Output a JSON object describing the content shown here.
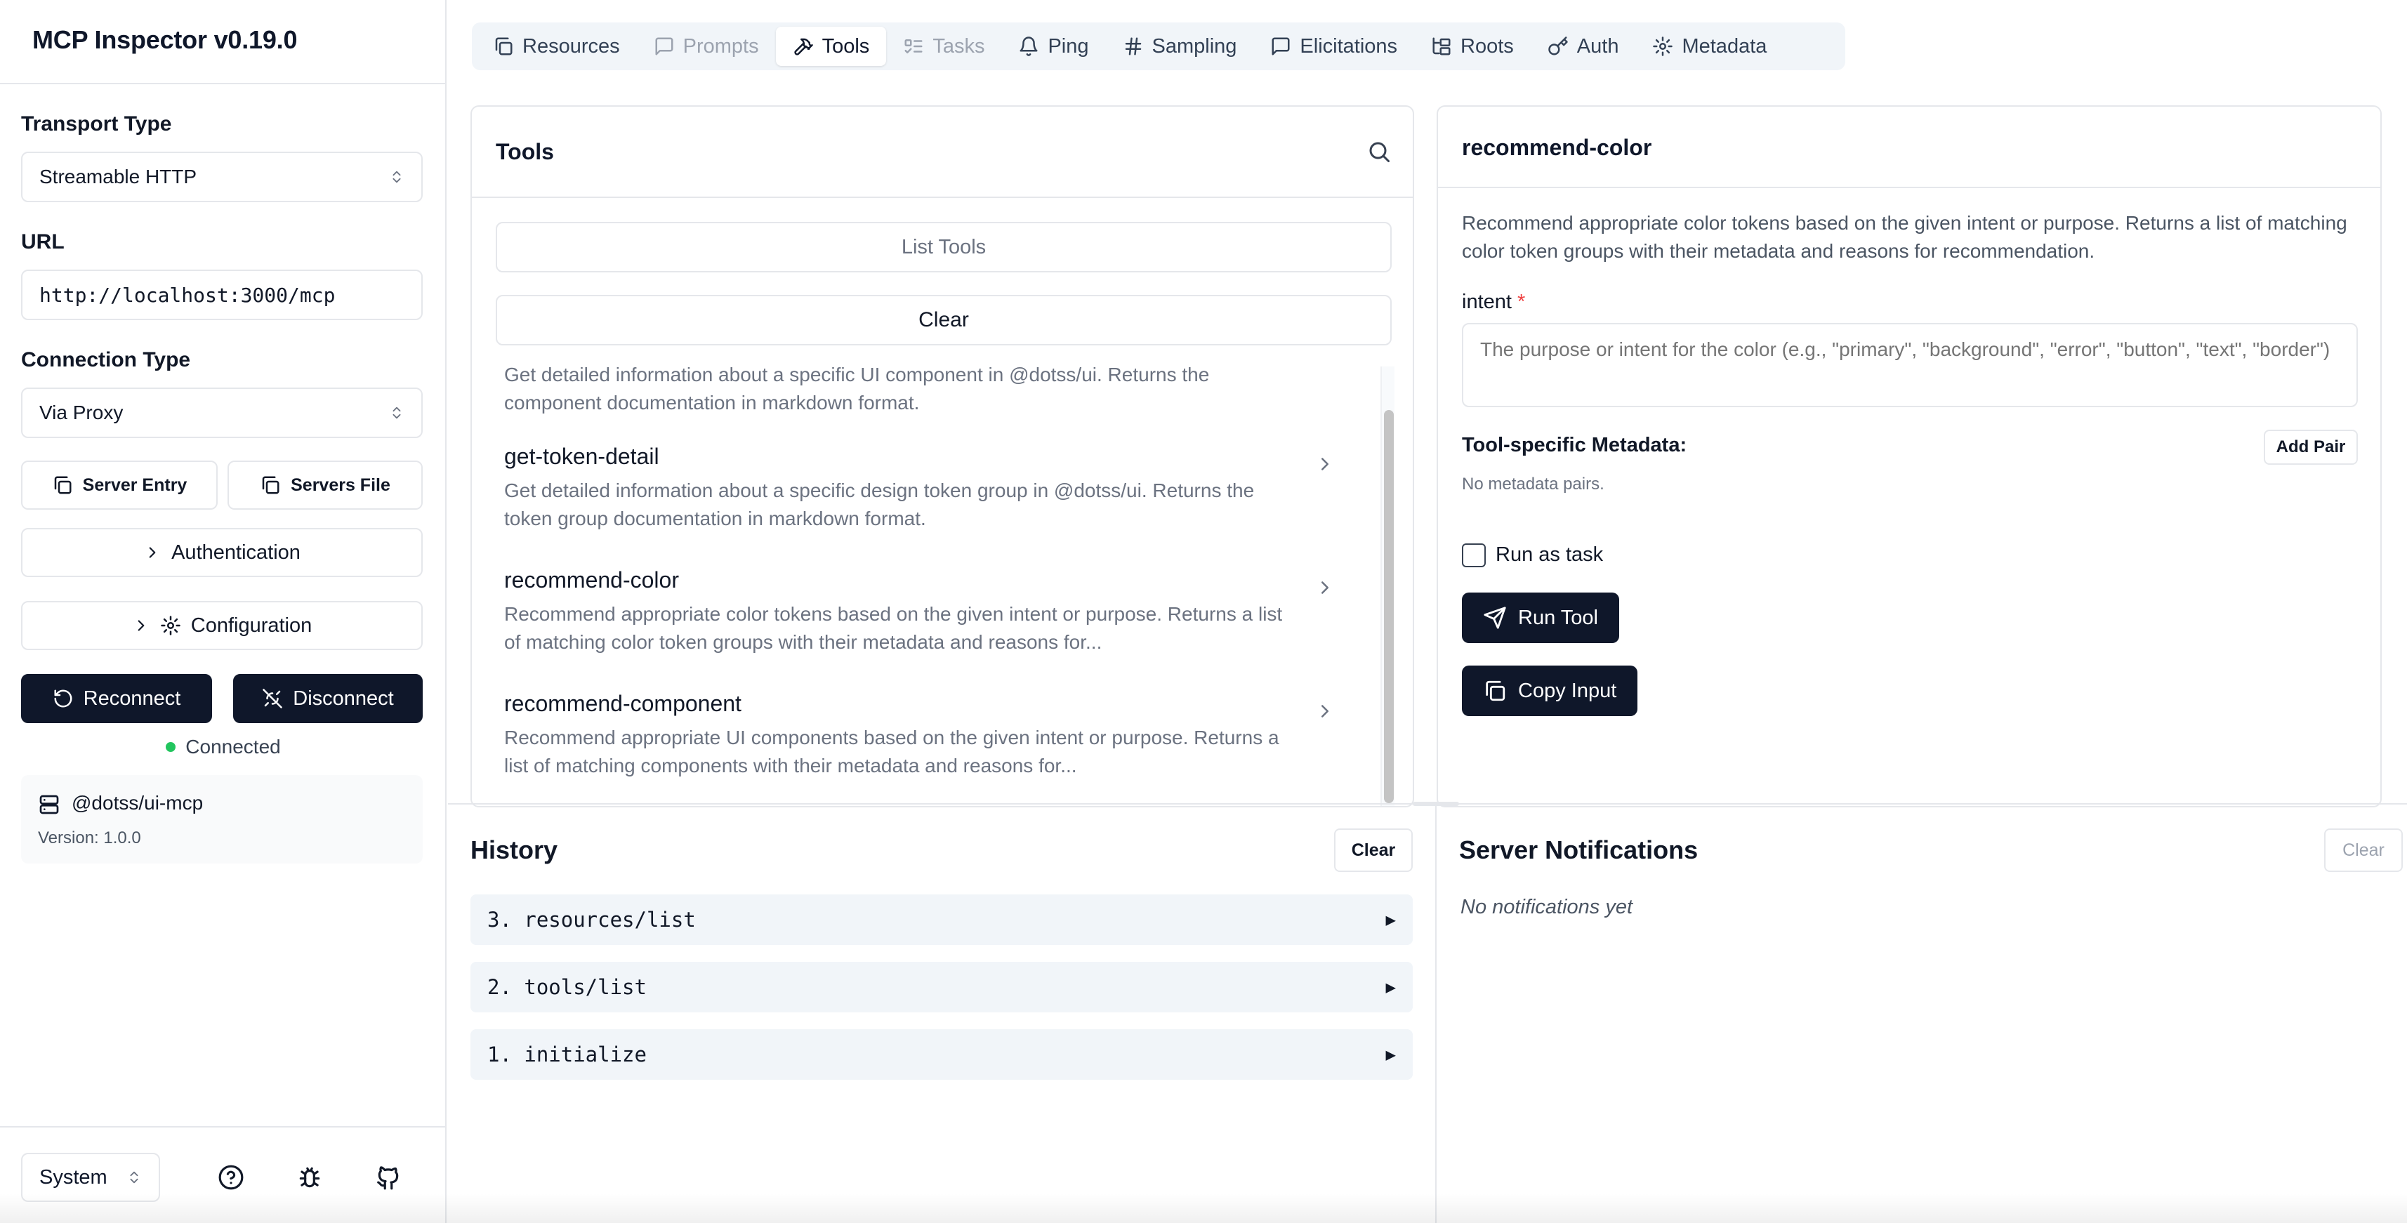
{
  "app": {
    "title": "MCP Inspector v0.19.0"
  },
  "sidebar": {
    "transport_label": "Transport Type",
    "transport_value": "Streamable HTTP",
    "url_label": "URL",
    "url_value": "http://localhost:3000/mcp",
    "connection_label": "Connection Type",
    "connection_value": "Via Proxy",
    "server_entry_label": "Server Entry",
    "servers_file_label": "Servers File",
    "authentication_label": "Authentication",
    "configuration_label": "Configuration",
    "reconnect_label": "Reconnect",
    "disconnect_label": "Disconnect",
    "status_text": "Connected",
    "status_color": "#22c55e",
    "server_name": "@dotss/ui-mcp",
    "server_version": "Version: 1.0.0",
    "theme_value": "System"
  },
  "tabs": [
    {
      "label": "Resources",
      "icon": "files-icon",
      "state": "normal"
    },
    {
      "label": "Prompts",
      "icon": "message-square-icon",
      "state": "disabled"
    },
    {
      "label": "Tools",
      "icon": "hammer-icon",
      "state": "active"
    },
    {
      "label": "Tasks",
      "icon": "list-todo-icon",
      "state": "disabled"
    },
    {
      "label": "Ping",
      "icon": "bell-icon",
      "state": "normal"
    },
    {
      "label": "Sampling",
      "icon": "hash-icon",
      "state": "normal"
    },
    {
      "label": "Elicitations",
      "icon": "message-square-icon",
      "state": "normal"
    },
    {
      "label": "Roots",
      "icon": "folder-tree-icon",
      "state": "normal"
    },
    {
      "label": "Auth",
      "icon": "key-icon",
      "state": "normal"
    },
    {
      "label": "Metadata",
      "icon": "gear-icon",
      "state": "normal"
    }
  ],
  "tools_panel": {
    "title": "Tools",
    "list_button": "List Tools",
    "clear_button": "Clear",
    "items": [
      {
        "name": "",
        "description": "Get detailed information about a specific UI component in @dotss/ui. Returns the component documentation in markdown format."
      },
      {
        "name": "get-token-detail",
        "description": "Get detailed information about a specific design token group in @dotss/ui. Returns the token group documentation in markdown format."
      },
      {
        "name": "recommend-color",
        "description": "Recommend appropriate color tokens based on the given intent or purpose. Returns a list of matching color token groups with their metadata and reasons for..."
      },
      {
        "name": "recommend-component",
        "description": "Recommend appropriate UI components based on the given intent or purpose. Returns a list of matching components with their metadata and reasons for..."
      }
    ]
  },
  "tool_detail": {
    "title": "recommend-color",
    "description": "Recommend appropriate color tokens based on the given intent or purpose. Returns a list of matching color token groups with their metadata and reasons for recommendation.",
    "intent_label": "intent",
    "intent_required": "*",
    "intent_placeholder": "The purpose or intent for the color (e.g., \"primary\", \"background\", \"error\", \"button\", \"text\", \"border\")",
    "metadata_label": "Tool-specific Metadata:",
    "add_pair_label": "Add Pair",
    "no_metadata": "No metadata pairs.",
    "run_as_task_label": "Run as task",
    "run_as_task_checked": false,
    "run_tool_label": "Run Tool",
    "copy_input_label": "Copy Input"
  },
  "history": {
    "title": "History",
    "clear_label": "Clear",
    "items": [
      {
        "label": "3. resources/list",
        "arrow": "▶"
      },
      {
        "label": "2. tools/list",
        "arrow": "▶"
      },
      {
        "label": "1. initialize",
        "arrow": "▶"
      }
    ]
  },
  "notifications": {
    "title": "Server Notifications",
    "clear_label": "Clear",
    "empty_text": "No notifications yet"
  }
}
